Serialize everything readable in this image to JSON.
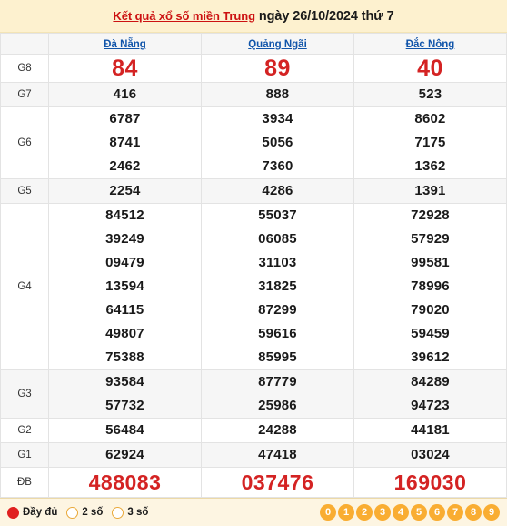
{
  "header": {
    "link_text": "Kết quả xổ số miền Trung",
    "date_text": "ngày 26/10/2024 thứ 7"
  },
  "table": {
    "corner_label": "",
    "provinces": [
      "Đà Nẵng",
      "Quảng Ngãi",
      "Đắc Nông"
    ],
    "rows": [
      {
        "label": "G8",
        "style": "big-red",
        "values": [
          [
            "84"
          ],
          [
            "89"
          ],
          [
            "40"
          ]
        ]
      },
      {
        "label": "G7",
        "style": "normal",
        "values": [
          [
            "416"
          ],
          [
            "888"
          ],
          [
            "523"
          ]
        ]
      },
      {
        "label": "G6",
        "style": "normal",
        "values": [
          [
            "6787",
            "8741",
            "2462"
          ],
          [
            "3934",
            "5056",
            "7360"
          ],
          [
            "8602",
            "7175",
            "1362"
          ]
        ]
      },
      {
        "label": "G5",
        "style": "normal",
        "values": [
          [
            "2254"
          ],
          [
            "4286"
          ],
          [
            "1391"
          ]
        ]
      },
      {
        "label": "G4",
        "style": "normal",
        "values": [
          [
            "84512",
            "39249",
            "09479",
            "13594",
            "64115",
            "49807",
            "75388"
          ],
          [
            "55037",
            "06085",
            "31103",
            "31825",
            "87299",
            "59616",
            "85995"
          ],
          [
            "72928",
            "57929",
            "99581",
            "78996",
            "79020",
            "59459",
            "39612"
          ]
        ]
      },
      {
        "label": "G3",
        "style": "normal",
        "values": [
          [
            "93584",
            "57732"
          ],
          [
            "87779",
            "25986"
          ],
          [
            "84289",
            "94723"
          ]
        ]
      },
      {
        "label": "G2",
        "style": "normal",
        "values": [
          [
            "56484"
          ],
          [
            "24288"
          ],
          [
            "44181"
          ]
        ]
      },
      {
        "label": "G1",
        "style": "normal",
        "values": [
          [
            "62924"
          ],
          [
            "47418"
          ],
          [
            "03024"
          ]
        ]
      },
      {
        "label": "ĐB",
        "style": "db-red",
        "values": [
          [
            "488083"
          ],
          [
            "037476"
          ],
          [
            "169030"
          ]
        ]
      }
    ]
  },
  "footer": {
    "filters": [
      {
        "label": "Đầy đủ",
        "selected": true
      },
      {
        "label": "2 số",
        "selected": false
      },
      {
        "label": "3 số",
        "selected": false
      }
    ],
    "digits": [
      "0",
      "1",
      "2",
      "3",
      "4",
      "5",
      "6",
      "7",
      "8",
      "9"
    ]
  },
  "colors": {
    "title_band": "#fdf1cf",
    "title_link": "#cc1111",
    "province_link": "#1155aa",
    "prize_red": "#d42323",
    "band_alt": "#f6f6f6",
    "footer_band": "#fdf5e2",
    "digit_chip": "#f9ad32",
    "radio_selected": "#e02020",
    "radio_border": "#e9a93a"
  }
}
